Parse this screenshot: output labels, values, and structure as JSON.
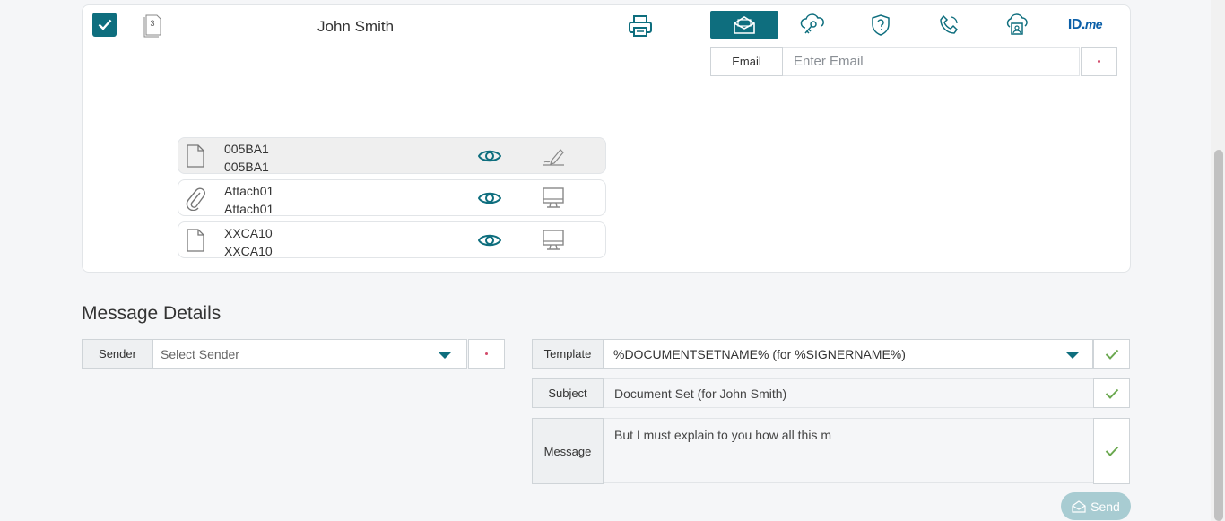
{
  "signer": {
    "name": "John Smith",
    "doc_count": "3",
    "selected": true
  },
  "auth": {
    "tabs": [
      {
        "icon": "email-envelope-icon",
        "active": true
      },
      {
        "icon": "cloud-key-icon",
        "active": false
      },
      {
        "icon": "shield-question-icon",
        "active": false
      },
      {
        "icon": "phone-icon",
        "active": false
      },
      {
        "icon": "cloud-id-icon",
        "active": false
      },
      {
        "icon": "idme-logo",
        "active": false
      }
    ],
    "idme_brand": "ID.",
    "idme_brand_suffix": "me",
    "email_label": "Email",
    "email_placeholder": "Enter Email",
    "email_value": ""
  },
  "documents": [
    {
      "title": "005BA1",
      "subtitle": "005BA1",
      "icon": "document-icon",
      "action": "signature-icon",
      "selected": true
    },
    {
      "title": "Attach01",
      "subtitle": "Attach01",
      "icon": "paperclip-icon",
      "action": "monitor-icon",
      "selected": false
    },
    {
      "title": "XXCA10",
      "subtitle": "XXCA10",
      "icon": "document-icon",
      "action": "monitor-icon",
      "selected": false
    }
  ],
  "message": {
    "section_title": "Message Details",
    "sender_label": "Sender",
    "sender_placeholder": "Select Sender",
    "template_label": "Template",
    "template_value": "%DOCUMENTSETNAME% (for %SIGNERNAME%)",
    "subject_label": "Subject",
    "subject_value": "Document Set (for John Smith)",
    "message_label": "Message",
    "message_value": "But I must explain to you how all this m",
    "send_label": "Send"
  },
  "colors": {
    "accent": "#0e6e7e",
    "check_green": "#6aa84f",
    "required_dot": "#d24a6a",
    "send_disabled": "#a8ccd2"
  }
}
